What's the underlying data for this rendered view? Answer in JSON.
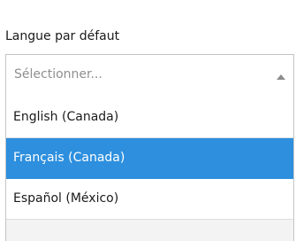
{
  "field": {
    "label": "Langue par défaut"
  },
  "select": {
    "placeholder": "Sélectionner...",
    "expanded": true,
    "caret_icon": "caret-up-icon"
  },
  "options": [
    {
      "label": "English (Canada)",
      "selected": false
    },
    {
      "label": "Français (Canada)",
      "selected": true
    },
    {
      "label": "Español (México)",
      "selected": false
    }
  ],
  "colors": {
    "selected_background": "#2d8fde",
    "selected_text": "#ffffff",
    "border": "#c4c4c4",
    "placeholder_text": "#8f8f8f"
  }
}
